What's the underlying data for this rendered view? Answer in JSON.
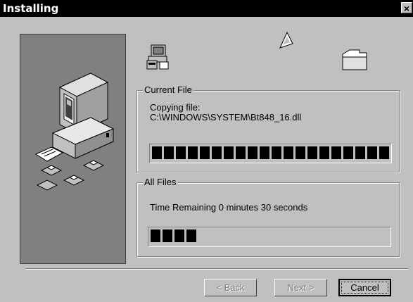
{
  "window": {
    "title": "Installing",
    "close_label": "×"
  },
  "current_file": {
    "group_label": "Current File",
    "status_line": "Copying file:",
    "path": "C:\\WINDOWS\\SYSTEM\\Bt848_16.dll",
    "progress": 1.0
  },
  "all_files": {
    "group_label": "All Files",
    "time_remaining": "Time Remaining 0 minutes 30 seconds",
    "progress": 0.2
  },
  "buttons": {
    "back": "< Back",
    "next": "Next >",
    "cancel": "Cancel"
  },
  "icons": [
    "computer-installer-icon",
    "setup-program-icon",
    "flying-paper-icon",
    "folder-icon",
    "floppy-disk-icon",
    "document-icon"
  ]
}
